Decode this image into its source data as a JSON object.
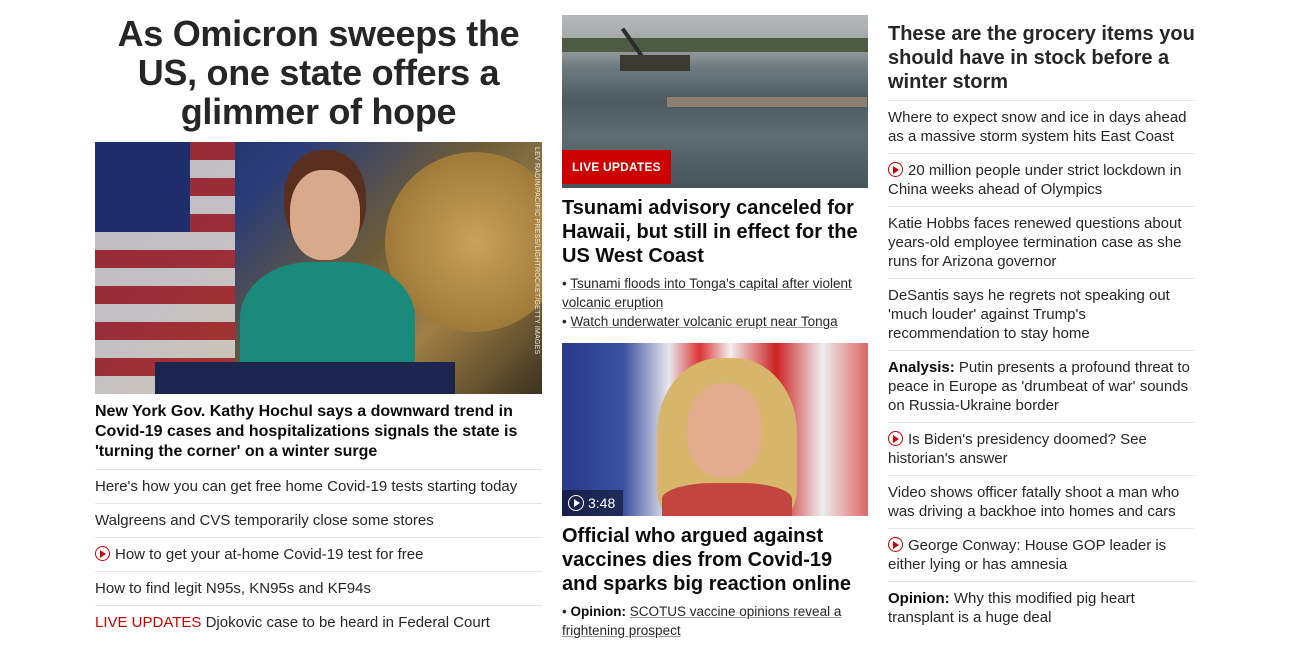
{
  "left": {
    "headline": "As Omicron sweeps the US, one state offers a glimmer of hope",
    "image_credit": "LEV RADIN/PACIFIC PRESS/LIGHTROCKET/GETTY IMAGES",
    "lead_text": "New York Gov. Kathy Hochul says a downward trend in Covid-19 cases and hospitalizations signals the state is 'turning the corner' on a winter surge",
    "links": [
      {
        "text": "Here's how you can get free home Covid-19 tests starting today"
      },
      {
        "text": "Walgreens and CVS temporarily close some stores"
      },
      {
        "text": "How to get your at-home Covid-19 test for free",
        "icon": "play-icon"
      },
      {
        "text": "How to find legit N95s, KN95s and KF94s"
      },
      {
        "prefix": "LIVE UPDATES",
        "text": " Djokovic case to be heard in Federal Court"
      }
    ]
  },
  "middle": {
    "story1": {
      "badge": "LIVE UPDATES",
      "headline": "Tsunami advisory canceled for Hawaii, but still in effect for the US West Coast",
      "bullets": [
        "Tsunami floods into Tonga's capital after violent volcanic eruption",
        "Watch underwater volcanic erupt near Tonga"
      ]
    },
    "story2": {
      "duration": "3:48",
      "headline": "Official who argued against vaccines dies from Covid-19 and sparks big reaction online",
      "bullet_label": "Opinion:",
      "bullet_text": "SCOTUS vaccine opinions reveal a frightening prospect"
    }
  },
  "right": {
    "headline": "These are the grocery items you should have in stock before a winter storm",
    "items": [
      {
        "text": "Where to expect snow and ice in days ahead as a massive storm system hits East Coast"
      },
      {
        "text": "20 million people under strict lockdown in China weeks ahead of Olympics",
        "icon": "play-icon"
      },
      {
        "text": "Katie Hobbs faces renewed questions about years-old employee termination case as she runs for Arizona governor"
      },
      {
        "text": "DeSantis says he regrets not speaking out 'much louder' against Trump's recommendation to stay home"
      },
      {
        "label": "Analysis:",
        "text": " Putin presents a profound threat to peace in Europe as 'drumbeat of war' sounds on Russia-Ukraine border"
      },
      {
        "text": "Is Biden's presidency doomed? See historian's answer",
        "icon": "play-icon"
      },
      {
        "text": "Video shows officer fatally shoot a man who was driving a backhoe into homes and cars"
      },
      {
        "text": "George Conway: House GOP leader is either lying or has amnesia",
        "icon": "play-icon"
      },
      {
        "label": "Opinion:",
        "text": " Why this modified pig heart transplant is a huge deal"
      }
    ]
  },
  "colors": {
    "accent_red": "#cc0000",
    "text": "#262626"
  }
}
